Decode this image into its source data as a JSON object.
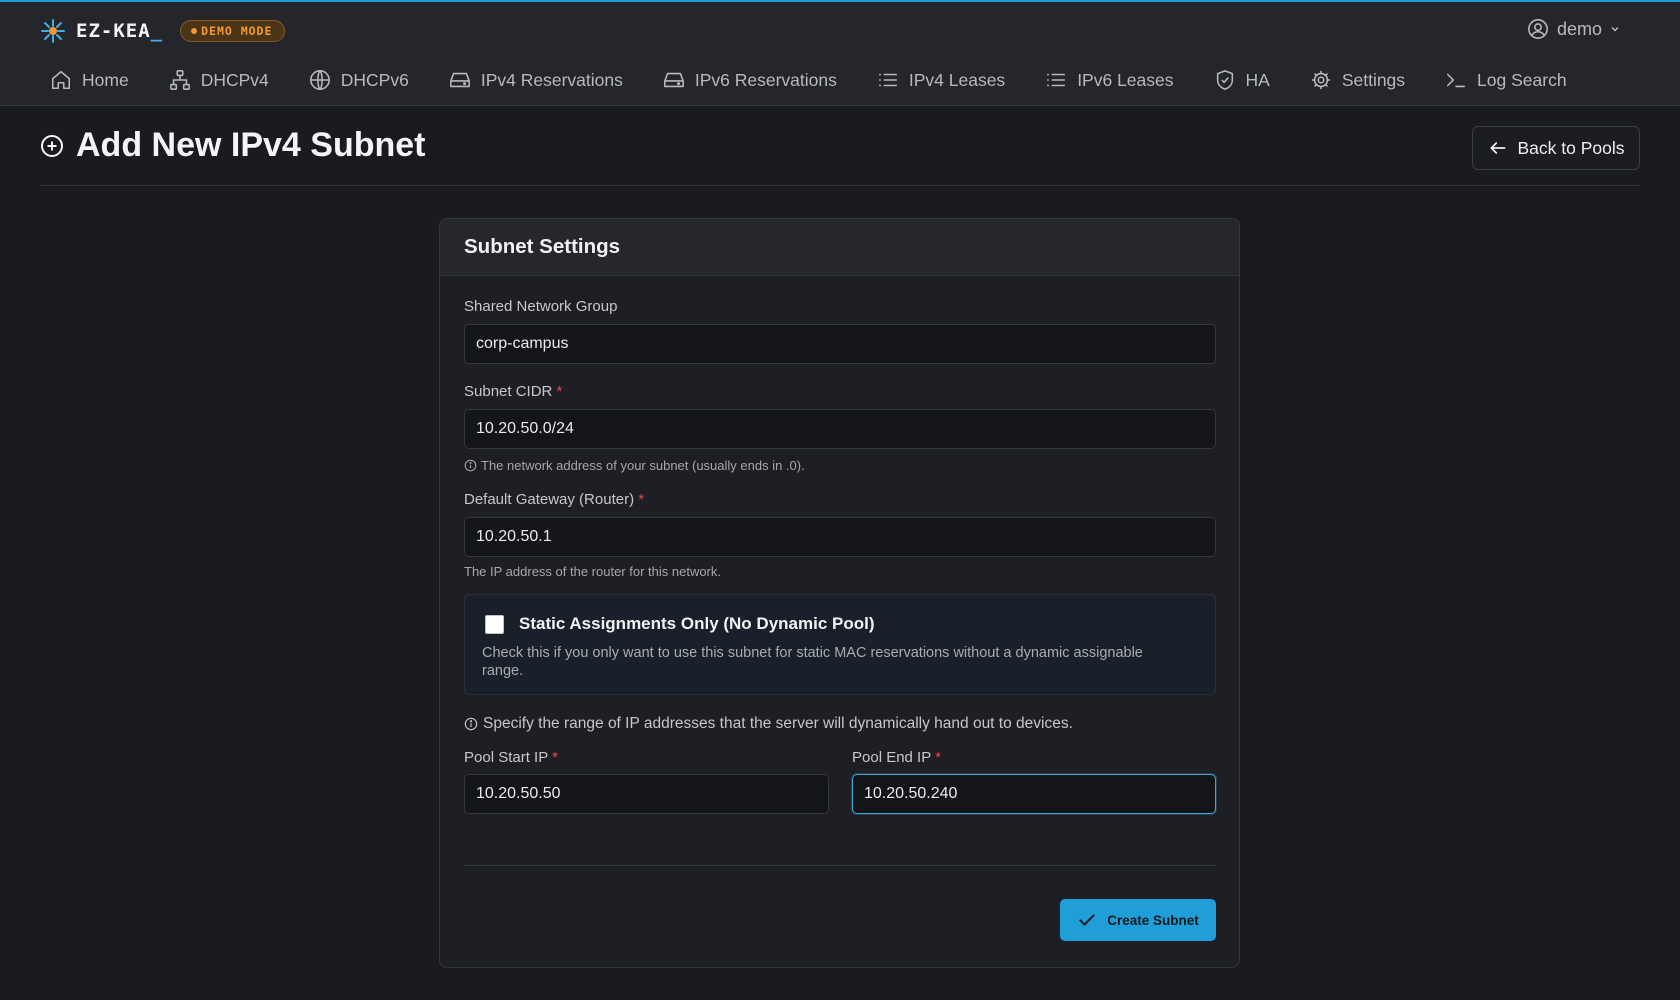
{
  "app": {
    "name": "EZ-KEA",
    "cursor": "_",
    "demo_badge": "DEMO MODE",
    "user": "demo",
    "accent_color": "#1f9ed8"
  },
  "nav": {
    "items": [
      {
        "label": "Home",
        "icon": "home-icon"
      },
      {
        "label": "DHCPv4",
        "icon": "network-icon"
      },
      {
        "label": "DHCPv6",
        "icon": "globe-icon"
      },
      {
        "label": "IPv4 Reservations",
        "icon": "drive-icon"
      },
      {
        "label": "IPv6 Reservations",
        "icon": "drive-icon"
      },
      {
        "label": "IPv4 Leases",
        "icon": "list-icon"
      },
      {
        "label": "IPv6 Leases",
        "icon": "list-icon"
      },
      {
        "label": "HA",
        "icon": "shield-check-icon"
      },
      {
        "label": "Settings",
        "icon": "gear-icon"
      },
      {
        "label": "Log Search",
        "icon": "terminal-icon"
      }
    ]
  },
  "page": {
    "title": "Add New IPv4 Subnet",
    "back_button": "Back to Pools"
  },
  "card": {
    "title": "Subnet Settings",
    "shared_network": {
      "label": "Shared Network Group",
      "value": "corp-campus"
    },
    "subnet_cidr": {
      "label": "Subnet CIDR",
      "required": "*",
      "value": "10.20.50.0/24",
      "help": "The network address of your subnet (usually ends in .0)."
    },
    "gateway": {
      "label": "Default Gateway (Router)",
      "required": "*",
      "value": "10.20.50.1",
      "help": "The IP address of the router for this network."
    },
    "static_only": {
      "label": "Static Assignments Only (No Dynamic Pool)",
      "checked": false,
      "description": "Check this if you only want to use this subnet for static MAC reservations without a dynamic assignable range."
    },
    "pool_note": "Specify the range of IP addresses that the server will dynamically hand out to devices.",
    "pool_start": {
      "label": "Pool Start IP",
      "required": "*",
      "value": "10.20.50.50"
    },
    "pool_end": {
      "label": "Pool End IP",
      "required": "*",
      "value": "10.20.50.240"
    },
    "submit": "Create Subnet"
  }
}
